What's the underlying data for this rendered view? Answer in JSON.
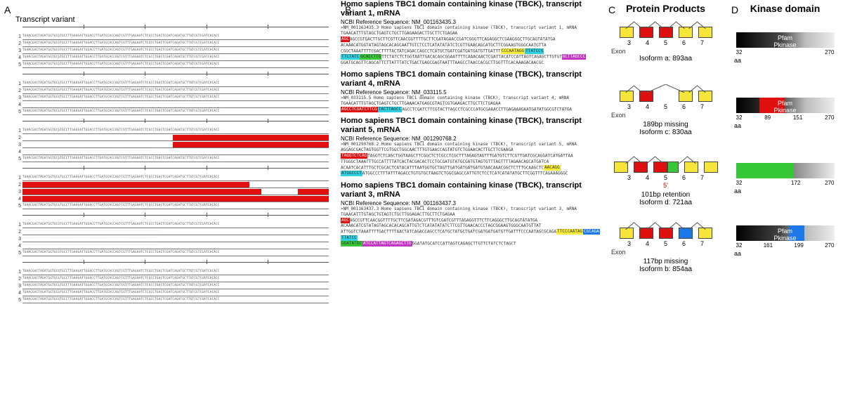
{
  "panels": {
    "A": "A",
    "B": "B",
    "C": "C",
    "D": "D"
  },
  "A": {
    "title": "Transcript variant",
    "row_ids": [
      "1",
      "2",
      "3",
      "4",
      "5"
    ],
    "dummy_seq": "TGAACGACTAGATGGTGCGTGCCTTGAAGATTGGACCTTGATGCACCAGTCGTTTGAGAATCTCGCCTGACTCGATCAGATGCTTGTCGTCGATCACACC"
  },
  "B": {
    "records": [
      {
        "title": "Homo sapiens TBC1 domain containing kinase (TBCK), transcript variant 1, mRNA",
        "ref": "NCBI Reference Sequence: NM_001163435.3",
        "fasta_head": ">NM_001163435.3 Homo sapiens TBC1 domain containing kinase (TBCK), transcript variant 1, mRNA",
        "lines": [
          "TGAACATTTGTAGCTGAGTCTGCTTGAGAAGACTTGCTTCTGAGAA",
          "AGCCGTGACTTGCTTCGTTCAACGGTTTTGCTTCGATAGAACCGATCGGGTTCAGAGGCTCGAAGGGCTTGCAGTATATGA",
          "ACAAACATGGTATAGTAGCACAGCAATTGTCTCCTCATATATATCTCGTTGAACAGCATGCTTCGGAAGTGGGCAATGTTA",
          "CGGCTAAATTTTCGACTTTTACTATCAGACCAGCCTCATGCTGATCGATGATGATGTTGATTT",
          "TTCTATCTCTGGTAATTGACACAGCGGAATTTTCAAACAACTCGATTACATCCATTAGTCAGAGCTTGTGT",
          "GGATGCAGTTCAGCATTCTTATTTATCTGACTGAGCGAGTAATTTAAGCCTAACCACGCTTGGTTTCACAAAGACAACGC"
        ]
      },
      {
        "title": "Homo sapiens TBC1 domain containing kinase (TBCK), transcript variant 4, mRNA",
        "ref": "NCBI Reference Sequence: NM_033115.5",
        "fasta_head": ">NM_033115.5 Homo sapiens TBC1 domain containing kinase (TBCK), transcript variant 4, mRNA",
        "lines": [
          "TGAACATTTGTAGCTGAGTCTGCTTGAAACATGAGCGTAGTCGTGAAGACTTGCTTCTGAGAA",
          "AGCCTCGATCTTCGTACTTAGCCTCGCCCATGCGAAACCTTGAGAAAGAATGATATGGCGTCTATGA"
        ]
      },
      {
        "title": "Homo sapiens TBC1 domain containing kinase (TBCK), transcript variant 5, mRNA",
        "ref": "NCBI Reference Sequence: NM_001290768.2",
        "fasta_head": ">NM_001290768.2 Homo sapiens TBC1 domain containing kinase (TBCK), transcript variant 5, mRNA",
        "lines": [
          "AGGAGCGACTAGTGGTTCGTGGCTGGCAACTTTGTGAACCAGTATGTCTGGAACACTTGCTTCGAAGA",
          "TAGGTCTCAGCTGGTAAGCTTCGGCTCTCGCCTCGCTTTAGAGTAGTTTGATGTCTTCGTTGATCGCAGGATCATGATTAA",
          "TTGGGCTAAATTTGCCATTTTATCACTACGACACTCCTGCGATGTATGCGATGTAGTGTTTAGTTTTAGAACAGCATGATCA",
          "ACAATCACATTTGCTCGCACTCATACATTTAATGGTGCTAGTTGATGATGATGATGTAACAAACGGCTCTTTGCAAGCTC",
          "ATGGCCCTTTATTTAGACCTGTGTGCTAAGTCTGGCGAGCCATTGTCTCCTCATCATATATGCTTCGGTTTCAGAAAGGGC"
        ]
      },
      {
        "title": "Homo sapiens TBC1 domain containing kinase (TBCK), transcript variant 3, mRNA",
        "ref": "NCBI Reference Sequence: NM_001163437.3",
        "fasta_head": ">NM_001163437.3 Homo sapiens TBC1 domain containing kinase (TBCK), transcript variant 3, mRNA",
        "lines": [
          "TGAACATTTGTAGCTGTAGTCTGCTTGGAGACTTGCTTCTGAGAA",
          "AGCCGTTCAACGGTTTTGCTTCGATAGACGTTTGTCGATCGTTTAGAGGTTTCTTCAGGGCTTGCAGTATATGA",
          "ACAAACATCGTATAGTAGCACACAGCATTGTCTCATATATATCTTCGTTGAACACCCTAGCGGAAGTGGGCAATGTTAT",
          "ATTGGTCTAAATTTTGACTTTTAACTATCAGACCAGCCTCATGCTATGCTGATCGATGATGATGTTGATTTCCCAATAGCGCAGA",
          "GGATATGCATCCATTAGTCAGAGCTTGTTCTATCTCTAGCT"
        ]
      }
    ]
  },
  "C": {
    "heading": "Protein Products",
    "exon_label": "Exon",
    "exon_nums": [
      "3",
      "4",
      "5",
      "6",
      "7"
    ],
    "ret5": "5'",
    "isoforms": [
      {
        "line1": "",
        "line2": "Isoform a: 893aa"
      },
      {
        "line1": "189bp missing",
        "line2": "Isoform c: 830aa"
      },
      {
        "line1": "101bp retention",
        "line2": "Isoform d: 721aa"
      },
      {
        "line1": "117bp missing",
        "line2": "Isoform b: 854aa"
      }
    ]
  },
  "D": {
    "heading": "Kinase domain",
    "aa": "aa",
    "pfam": "Pfam",
    "pk": "Pkinase",
    "bars": [
      {
        "ticks": [
          "32",
          "",
          "",
          "270"
        ]
      },
      {
        "ticks": [
          "32",
          "89",
          "151",
          "270"
        ]
      },
      {
        "ticks": [
          "32",
          "",
          "172",
          "270"
        ]
      },
      {
        "ticks": [
          "32",
          "161",
          "199",
          "270"
        ]
      }
    ]
  }
}
